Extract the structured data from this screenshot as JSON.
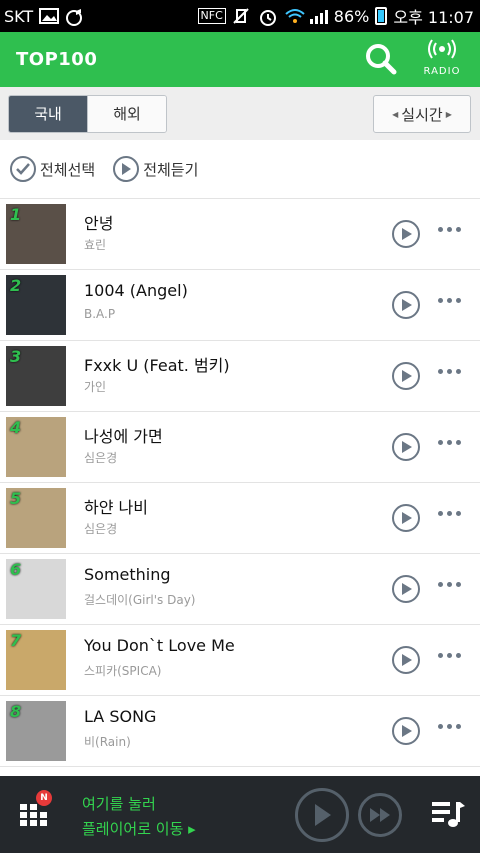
{
  "status_bar": {
    "carrier": "SKT",
    "nfc": "NFC",
    "battery": "86%",
    "time": "오후 11:07"
  },
  "header": {
    "title": "TOP100",
    "radio_label": "RADIO"
  },
  "tabs": {
    "domestic": "국내",
    "foreign": "해외",
    "period": "실시간"
  },
  "actions": {
    "select_all": "전체선택",
    "play_all": "전체듣기"
  },
  "songs": [
    {
      "rank": "1",
      "title": "안녕",
      "artist": "효린",
      "cover": "#5a5048"
    },
    {
      "rank": "2",
      "title": "1004 (Angel)",
      "artist": "B.A.P",
      "cover": "#2e3338"
    },
    {
      "rank": "3",
      "title": "Fxxk U (Feat. 범키)",
      "artist": "가인",
      "cover": "#3e3e3e"
    },
    {
      "rank": "4",
      "title": "나성에 가면",
      "artist": "심은경",
      "cover": "#b9a37d"
    },
    {
      "rank": "5",
      "title": "하얀 나비",
      "artist": "심은경",
      "cover": "#b9a37d"
    },
    {
      "rank": "6",
      "title": "Something",
      "artist": "걸스데이(Girl's Day)",
      "cover": "#d8d8d8"
    },
    {
      "rank": "7",
      "title": "You Don`t Love Me",
      "artist": "스피카(SPICA)",
      "cover": "#c9a86a"
    },
    {
      "rank": "8",
      "title": "LA SONG",
      "artist": "비(Rain)",
      "cover": "#9a9a9a"
    }
  ],
  "player": {
    "badge": "N",
    "message_line1": "여기를 눌러",
    "message_line2": "플레이어로 이동 ▸"
  },
  "colors": {
    "accent": "#2fbf4f",
    "tab_active": "#4b5866",
    "player_bg": "#24282c",
    "icon_gray": "#6b7785"
  }
}
